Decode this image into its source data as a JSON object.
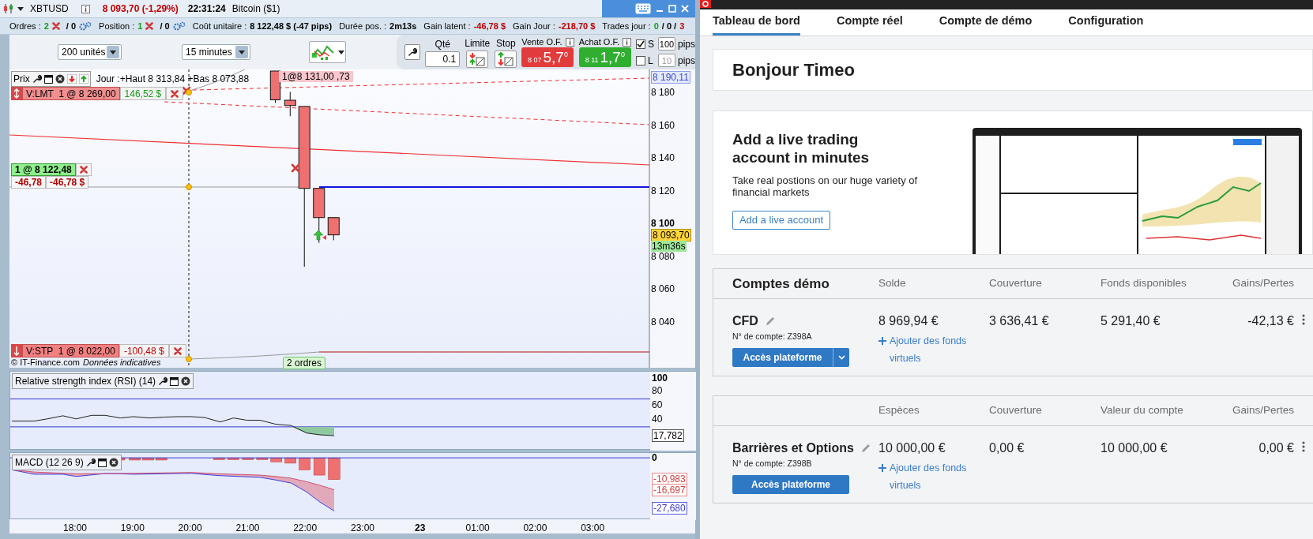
{
  "platform": {
    "title_bar": {
      "symbol": "XBTUSD",
      "quote": "8 093,70 (-1,29%)",
      "time": "22:31:24",
      "instrument": "Bitcoin ($1)"
    },
    "stats": [
      {
        "kind": "orders",
        "label": "Ordres :",
        "count": "2",
        "rest": "/ 0"
      },
      {
        "kind": "orders",
        "label": "Position :",
        "count": "1",
        "rest": "/ 0"
      },
      {
        "kind": "value",
        "label": "Coût unitaire :",
        "parts": [
          {
            "text": "8 122,48 $ (-47 pips)",
            "color": "#000000"
          }
        ]
      },
      {
        "kind": "value",
        "label": "Durée pos. :",
        "parts": [
          {
            "text": "2m13s",
            "color": "#000000"
          }
        ]
      },
      {
        "kind": "value",
        "label": "Gain latent :",
        "parts": [
          {
            "text": "-46,78 $",
            "color": "#c00000"
          }
        ]
      },
      {
        "kind": "value",
        "label": "Gain Jour :",
        "parts": [
          {
            "text": "-218,70 $",
            "color": "#c00000"
          }
        ]
      },
      {
        "kind": "value",
        "label": "Trades jour :",
        "parts": [
          {
            "text": "0",
            "color": "#1a9a1a"
          },
          {
            "text": "/ 0 /",
            "color": "#000000"
          },
          {
            "text": "3",
            "color": "#c00000"
          }
        ]
      }
    ],
    "toolbar": {
      "size_select": "200 unités",
      "period_select": "15 minutes",
      "qty_label": "Qté",
      "qty_value": "0.1",
      "limit_label": "Limite",
      "stop_label": "Stop",
      "sell": {
        "label": "Vente O.F.",
        "small": "8 07",
        "big": "5,7",
        "sup": "0"
      },
      "buy": {
        "label": "Achat O.F.",
        "small": "8 11",
        "big": "1,7",
        "sup": "0"
      },
      "pip_settings": [
        {
          "letter": "S",
          "checked": true,
          "value": "100",
          "unit": "pips"
        },
        {
          "letter": "L",
          "checked": false,
          "value": "10",
          "unit": "pips"
        }
      ]
    },
    "price_chart": {
      "title": "Prix",
      "info": "Jour :+Haut 8 313,84 +Bas 8 073,88",
      "trade_label": "1@8 131,00 ,73",
      "orders": [
        {
          "kind": "limit",
          "label": "V:LMT  1 @ 8 269,00",
          "pnl": "146,52 $",
          "color": "#1a9a1a"
        },
        {
          "kind": "stop",
          "label": "V:STP  1 @ 8 022,00",
          "pnl": "-100,48 $",
          "color": "#c00000"
        }
      ],
      "position": {
        "label": "1 @ 8 122,48",
        "points": "-46,78",
        "amount": "-46,78 $"
      },
      "credit": "© IT-Finance.com",
      "notice": "Données indicatives",
      "orders_badge": "2 ordres",
      "axis": [
        {
          "text": "8 190,11",
          "kind": "high"
        },
        {
          "text": "8 180",
          "kind": "tick"
        },
        {
          "text": "8 160",
          "kind": "tick"
        },
        {
          "text": "8 140",
          "kind": "tick"
        },
        {
          "text": "8 120",
          "kind": "tick"
        },
        {
          "text": "8 100",
          "kind": "major"
        },
        {
          "text": "8 093,70",
          "kind": "last"
        },
        {
          "text": "13m36s",
          "kind": "timer"
        },
        {
          "text": "8 080",
          "kind": "tick"
        },
        {
          "text": "8 060",
          "kind": "tick"
        },
        {
          "text": "8 040",
          "kind": "tick"
        }
      ]
    },
    "rsi": {
      "title": "Relative strength index (RSI) (14)",
      "axis": [
        {
          "text": "100",
          "kind": "major"
        },
        {
          "text": "80",
          "kind": "tick"
        },
        {
          "text": "60",
          "kind": "tick"
        },
        {
          "text": "40",
          "kind": "tick"
        },
        {
          "text": "17,782",
          "kind": "current"
        }
      ]
    },
    "macd": {
      "title": "MACD (12 26 9)",
      "axis": [
        {
          "text": "0",
          "kind": "major"
        },
        {
          "text": "-10,983",
          "kind": "signal"
        },
        {
          "text": "-16,697",
          "kind": "signal"
        },
        {
          "text": "-27,680",
          "kind": "macd"
        }
      ]
    },
    "time_axis": [
      {
        "text": "18:00",
        "bold": false
      },
      {
        "text": "19:00",
        "bold": false
      },
      {
        "text": "20:00",
        "bold": false
      },
      {
        "text": "21:00",
        "bold": false
      },
      {
        "text": "22:00",
        "bold": false
      },
      {
        "text": "23:00",
        "bold": false
      },
      {
        "text": "23",
        "bold": true
      },
      {
        "text": "01:00",
        "bold": false
      },
      {
        "text": "02:00",
        "bold": false
      },
      {
        "text": "03:00",
        "bold": false
      }
    ]
  },
  "dashboard": {
    "tabs": [
      {
        "label": "Tableau de bord",
        "selected": true
      },
      {
        "label": "Compte réel",
        "selected": false
      },
      {
        "label": "Compte de démo",
        "selected": false
      },
      {
        "label": "Configuration",
        "selected": false
      }
    ],
    "greeting": "Bonjour Timeo",
    "promo": {
      "title": "Add a live trading account in minutes",
      "text": "Take real postions on our huge variety of financial markets",
      "button": "Add a live account"
    },
    "account_groups": [
      {
        "title": "Comptes démo",
        "columns": [
          "Solde",
          "Couverture",
          "Fonds disponibles",
          "Gains/Pertes"
        ],
        "accounts": [
          {
            "name": "CFD",
            "number": "N° de compte: Z398A",
            "button": "Accès plateforme",
            "dropdown": true,
            "values": [
              "8 969,94 €",
              "3 636,41 €",
              "5 291,40 €",
              "-42,13 €"
            ],
            "add_funds": "Ajouter des fonds virtuels"
          }
        ]
      },
      {
        "columns": [
          "Espèces",
          "Couverture",
          "Valeur du compte",
          "Gains/Pertes"
        ],
        "accounts": [
          {
            "name": "Barrières et Options",
            "number": "N° de compte: Z398B",
            "button": "Accès plateforme",
            "dropdown": false,
            "values": [
              "10 000,00 €",
              "0,00 €",
              "10 000,00 €",
              "0,00 €"
            ],
            "add_funds": "Ajouter des fonds virtuels"
          }
        ]
      }
    ]
  }
}
